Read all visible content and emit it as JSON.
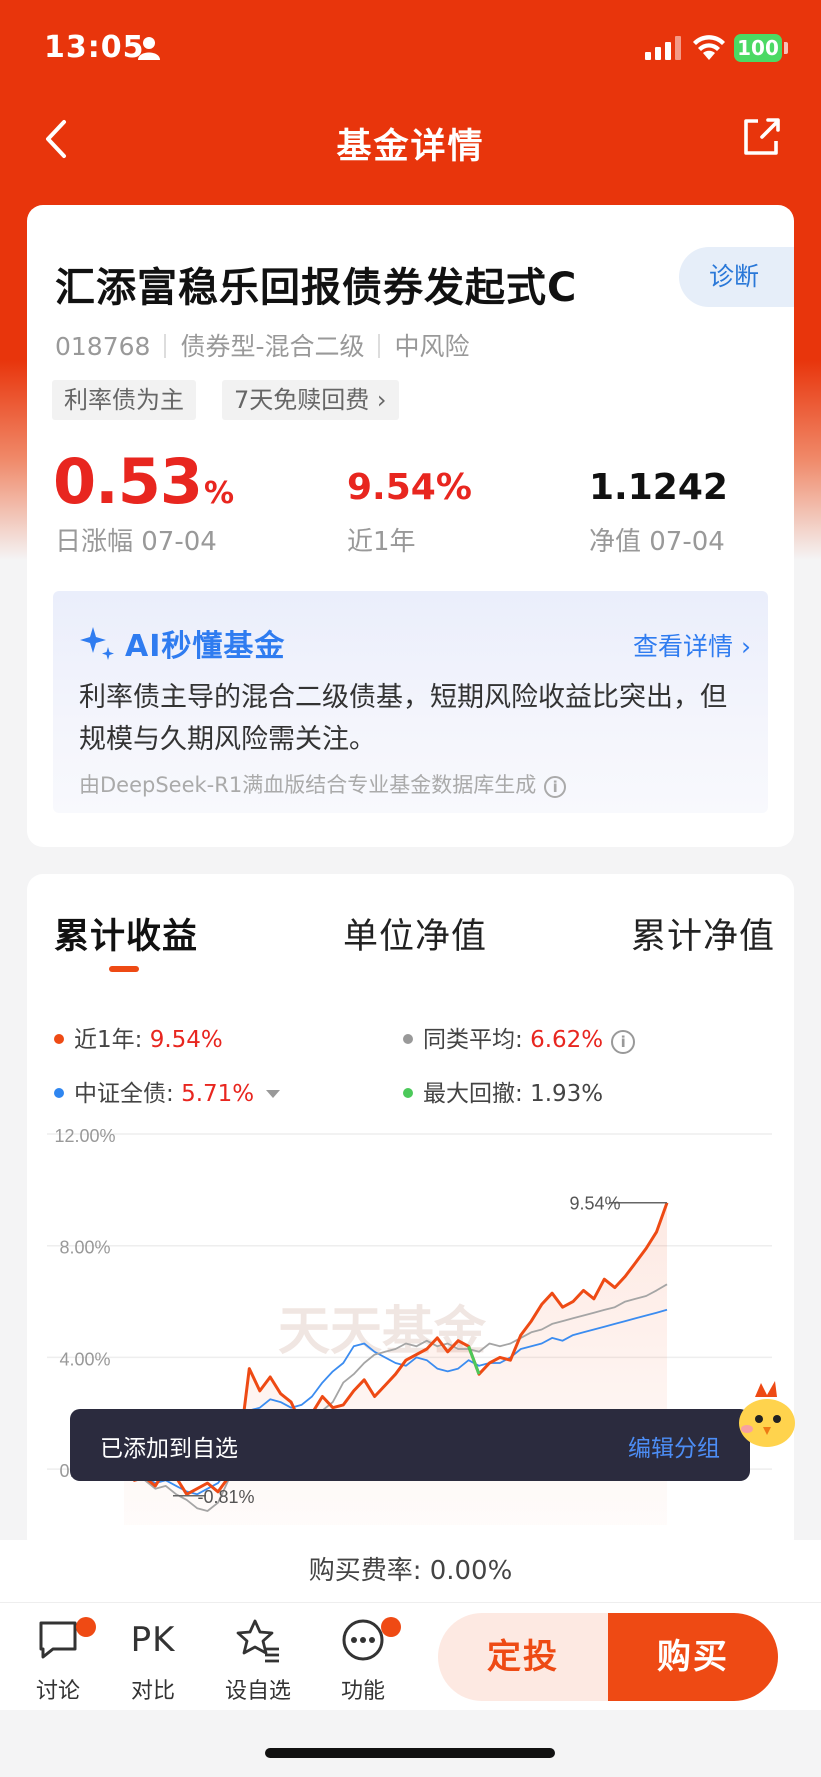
{
  "status_bar": {
    "time": "13:05",
    "battery": "100"
  },
  "nav": {
    "title": "基金详情"
  },
  "fund": {
    "name": "汇添富稳乐回报债券发起式C",
    "code": "018768",
    "type": "债券型-混合二级",
    "risk": "中风险",
    "diagnose": "诊断",
    "tags": [
      "利率债为主",
      "7天免赎回费 ›"
    ],
    "daily_change": "0.53",
    "pct_sign": "%",
    "daily_label": "日涨幅 07-04",
    "year_return": "9.54%",
    "year_label": "近1年",
    "nav_value": "1.1242",
    "nav_label": "净值 07-04"
  },
  "ai": {
    "title": "AI秒懂基金",
    "more": "查看详情 ›",
    "text": "利率债主导的混合二级债基，短期风险收益比突出，但规模与久期风险需关注。",
    "source": "由DeepSeek-R1满血版结合专业基金数据库生成"
  },
  "chart_tabs": [
    "累计收益",
    "单位净值",
    "累计净值"
  ],
  "legend": [
    {
      "label": "近1年: ",
      "value": "9.54%",
      "color": "#ee4a14"
    },
    {
      "label": "同类平均: ",
      "value": "6.62%",
      "color": "#999999"
    },
    {
      "label": "中证全债: ",
      "value": "5.71%",
      "color": "#2f86f0"
    },
    {
      "label": "最大回撤: ",
      "value": "1.93%",
      "color": "#4cc95a"
    }
  ],
  "chart_data": {
    "type": "line",
    "yticks": [
      "12.00%",
      "8.00%",
      "4.00%",
      "0.00%"
    ],
    "ylim": [
      -2,
      12
    ],
    "series": [
      {
        "name": "近1年",
        "end_value": 9.54,
        "values": [
          0.1,
          -0.4,
          -0.3,
          -0.6,
          0.0,
          -0.3,
          -0.9,
          -0.7,
          -0.5,
          -0.81,
          -0.3,
          0.6,
          3.6,
          2.8,
          3.3,
          2.7,
          2.4,
          1.6,
          2.0,
          2.6,
          2.2,
          2.3,
          2.8,
          3.2,
          2.6,
          3.0,
          3.4,
          3.9,
          4.1,
          4.3,
          4.7,
          4.2,
          4.6,
          4.4,
          3.4,
          3.8,
          4.0,
          3.9,
          4.8,
          5.3,
          5.9,
          6.3,
          5.8,
          6.0,
          6.4,
          6.1,
          6.8,
          6.5,
          6.9,
          7.4,
          7.9,
          8.5,
          9.54
        ]
      },
      {
        "name": "同类平均",
        "end_value": 6.62,
        "values": [
          0.0,
          -0.2,
          -0.4,
          -0.7,
          -0.6,
          -0.9,
          -1.1,
          -1.4,
          -1.5,
          -1.2,
          -0.4,
          0.8,
          1.6,
          1.5,
          1.6,
          1.4,
          1.2,
          1.3,
          1.8,
          2.1,
          2.4,
          3.1,
          3.4,
          3.8,
          4.1,
          4.2,
          4.3,
          4.5,
          4.4,
          4.6,
          4.4,
          4.5,
          4.3,
          4.3,
          4.2,
          4.5,
          4.4,
          4.5,
          4.7,
          4.9,
          5.0,
          5.2,
          5.3,
          5.4,
          5.5,
          5.6,
          5.7,
          5.8,
          6.0,
          6.1,
          6.2,
          6.4,
          6.62
        ]
      },
      {
        "name": "中证全债",
        "end_value": 5.71,
        "values": [
          0.0,
          -0.2,
          -0.3,
          -0.5,
          -0.4,
          -0.6,
          -0.8,
          -0.9,
          -0.7,
          -0.5,
          0.0,
          0.9,
          2.1,
          2.2,
          2.5,
          2.4,
          2.2,
          2.3,
          2.6,
          3.1,
          3.5,
          3.8,
          4.4,
          4.5,
          4.2,
          4.0,
          3.8,
          3.7,
          4.0,
          3.9,
          3.6,
          3.5,
          3.6,
          3.9,
          3.7,
          3.8,
          3.8,
          4.0,
          4.3,
          4.4,
          4.5,
          4.7,
          4.6,
          4.8,
          4.9,
          5.0,
          5.1,
          5.2,
          5.3,
          5.4,
          5.5,
          5.6,
          5.71
        ]
      }
    ],
    "annotations": {
      "max": "9.54%",
      "min": "-0.81%"
    },
    "watermark": "天天基金"
  },
  "toast": {
    "message": "已添加到自选",
    "action": "编辑分组"
  },
  "fee": {
    "text": "购买费率: 0.00%"
  },
  "bottom": {
    "items": [
      "讨论",
      "对比",
      "设自选",
      "功能"
    ],
    "pk": "PK",
    "plan_button": "定投",
    "buy_button": "购买"
  }
}
